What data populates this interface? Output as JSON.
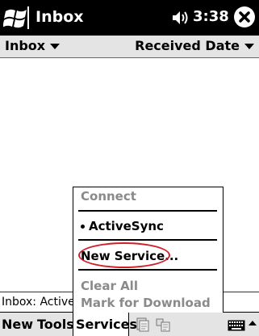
{
  "titlebar": {
    "app_title": "Inbox",
    "clock": "3:38",
    "start_icon": "windows-flag-icon",
    "speaker_icon": "speaker-icon",
    "close_icon": "close-icon"
  },
  "header": {
    "folder_label": "Inbox",
    "sort_label": "Received Date"
  },
  "status": {
    "text": "Inbox: Active"
  },
  "cmdbar": {
    "new_label": "New",
    "tools_label": "Tools",
    "services_label": "Services",
    "icons": [
      "send-receive-icon",
      "folder-icon",
      "keyboard-icon",
      "sip-up-arrow-icon"
    ]
  },
  "services_menu": {
    "connect": "Connect",
    "activesync": "ActiveSync",
    "new_service": "New Service...",
    "clear_all": "Clear All",
    "mark_for_download": "Mark for Download"
  },
  "colors": {
    "titlebar_bg": "#000000",
    "bar_bg": "#e4e4e4",
    "disabled_text": "#8a8a8a",
    "highlight_ring": "#d0202a"
  }
}
